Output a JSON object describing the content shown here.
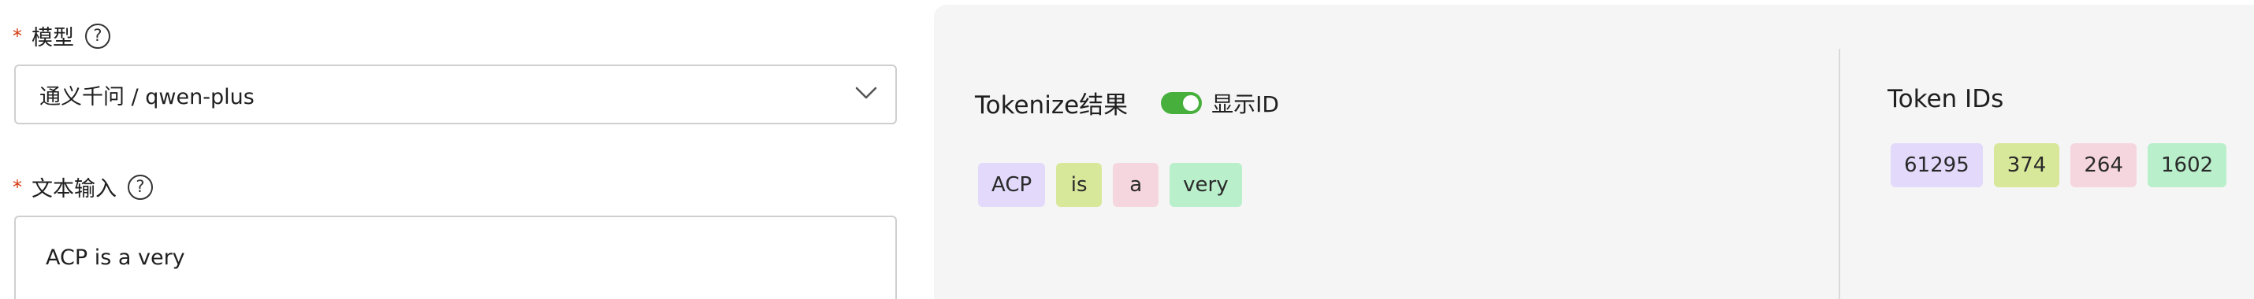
{
  "form": {
    "model_field": {
      "required_mark": "*",
      "label": "模型",
      "help_icon": "?"
    },
    "model_select": {
      "value": "通义千问 / qwen-plus",
      "icon": "chevron-down-icon"
    },
    "text_field": {
      "required_mark": "*",
      "label": "文本输入",
      "help_icon": "?"
    },
    "text_input": {
      "value": "ACP is a very"
    }
  },
  "result": {
    "tokenize_title": "Tokenize结果",
    "show_id_toggle": {
      "label": "显示ID",
      "on": true,
      "color": "#47b03c"
    },
    "tokens": [
      {
        "text": "ACP",
        "color": "#e3d9fb"
      },
      {
        "text": "is",
        "color": "#d8e89a"
      },
      {
        "text": "a",
        "color": "#f6d6de"
      },
      {
        "text": "very",
        "color": "#b9efca"
      }
    ],
    "token_ids_title": "Token IDs",
    "token_ids": [
      {
        "text": "61295",
        "color": "#e3d9fb"
      },
      {
        "text": "374",
        "color": "#d8e89a"
      },
      {
        "text": "264",
        "color": "#f6d6de"
      },
      {
        "text": "1602",
        "color": "#b9efca"
      }
    ]
  }
}
